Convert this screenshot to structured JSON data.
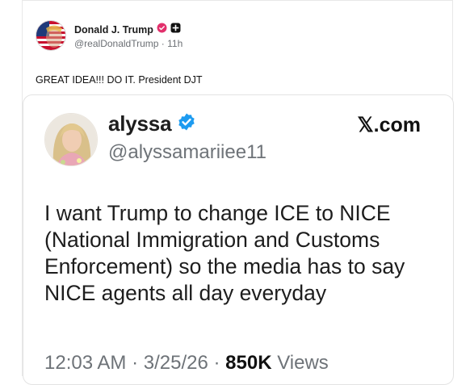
{
  "post": {
    "display_name": "Donald J. Trump",
    "handle": "@realDonaldTrump",
    "separator": "·",
    "time_ago": "11h",
    "text": "GREAT IDEA!!! DO IT.  President DJT"
  },
  "embed": {
    "display_name": "alyssa",
    "handle": "@alyssamariiee11",
    "site": "𝕏.com",
    "text": "I want Trump to change ICE to NICE (National Immigration and Customs Enforcement) so the media has to say NICE agents all day everyday",
    "time": "12:03 AM",
    "sep1": "·",
    "date": "3/25/26",
    "sep2": "·",
    "views_count": "850K",
    "views_label": "Views"
  },
  "colors": {
    "verified_pink": "#e2306c",
    "verified_blue": "#1d9bf0",
    "text_dark": "#1d1d1d",
    "text_muted": "#6e7378"
  }
}
